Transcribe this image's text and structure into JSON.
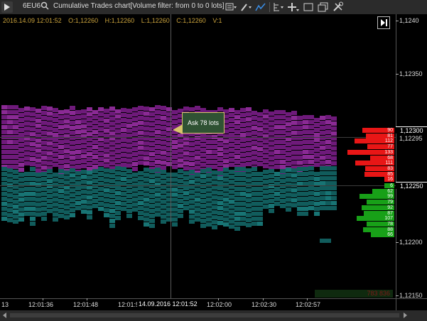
{
  "titlebar": {
    "symbol": "6EU6",
    "title": "Cumulative Trades chart[Volume filter: from 0 to 0 lots]"
  },
  "toolbar": {
    "icons": [
      "template-icon",
      "pencil-icon",
      "line-chart-icon",
      "indicator-icon",
      "crosshair-icon",
      "window-icon",
      "copy-icon",
      "settings-icon"
    ]
  },
  "ohlc": {
    "datetime": "2016.14.09 12:01:52",
    "open": "O:1,12260",
    "high": "H:1,12260",
    "low": "L:1,12260",
    "close": "C:1,12260",
    "volume": "V:1"
  },
  "tooltip": {
    "text": "Ask 78 lots"
  },
  "yaxis": {
    "labels": [
      "1,1240",
      "1,12350",
      "1,12300",
      "1,12295",
      "1,12250",
      "1,12200",
      "1,12150"
    ],
    "marker_top": "1,12300",
    "marker_bottom": "1,12250"
  },
  "xaxis": {
    "labels": [
      "13",
      "12:01:36",
      "12:01:48",
      "12:01:52",
      "12:02:00",
      "12:02:30",
      "12:02:57"
    ],
    "cursor_label": "14.09.2016 12:01:52"
  },
  "cumulative_total": "783 836",
  "ask_volumes": [
    "90",
    "81",
    "112",
    "77",
    "133",
    "68",
    "111",
    "83",
    "85",
    "16"
  ],
  "bid_volumes": [
    "6",
    "62",
    "99",
    "79",
    "92",
    "87",
    "107",
    "78",
    "88",
    "66"
  ],
  "colors": {
    "ask": "#e81616",
    "bid": "#18a018",
    "ask_cells": "#6e1a7a",
    "bid_cells": "#115c5c",
    "tooltip_border": "#d8c36a"
  }
}
